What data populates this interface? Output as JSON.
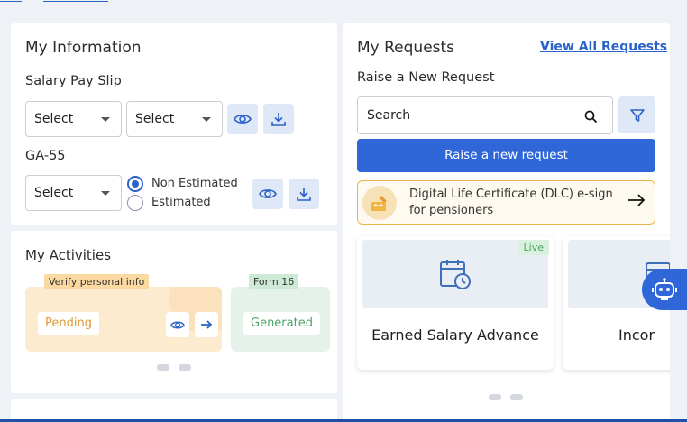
{
  "info": {
    "title": "My Information",
    "salary_label": "Salary Pay Slip",
    "select1": "Select",
    "select2": "Select",
    "ga_label": "GA-55",
    "select3": "Select",
    "radio_non_estimated": "Non Estimated",
    "radio_estimated": "Estimated",
    "radio_selected": "Non Estimated"
  },
  "activities": {
    "title": "My Activities",
    "cards": [
      {
        "tag": "Verify personal info",
        "status": "Pending"
      },
      {
        "tag": "Form 16",
        "status": "Generated"
      }
    ]
  },
  "requests": {
    "title": "My Requests",
    "view_all": "View All Requests",
    "raise_label": "Raise a New Request",
    "search_placeholder": "Search",
    "raise_button": "Raise a new request",
    "dlc_text": "Digital Life Certificate (DLC) e-sign for pensioners",
    "services": [
      {
        "title": "Earned Salary Advance",
        "badge": "Live"
      },
      {
        "title": "Incor"
      }
    ]
  },
  "colors": {
    "primary": "#2f67d8",
    "pending_bg": "#fdebd0",
    "generated_bg": "#e4f2ea",
    "live_badge": "#4aa564"
  },
  "icons": [
    "eye-icon",
    "download-icon",
    "search-icon",
    "filter-icon",
    "arrow-right-icon",
    "calendar-clock-icon",
    "signature-icon",
    "chatbot-icon"
  ]
}
